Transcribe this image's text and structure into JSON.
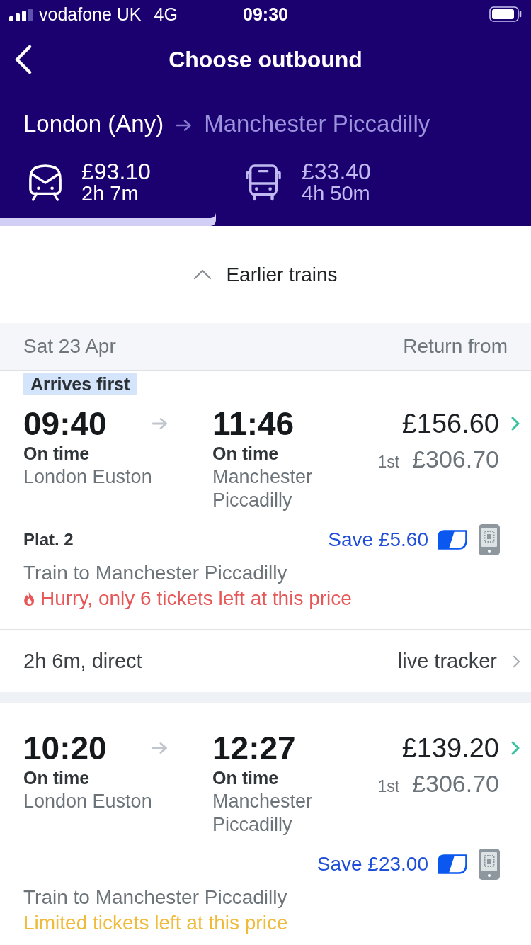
{
  "status_bar": {
    "carrier": "vodafone UK",
    "network": "4G",
    "time": "09:30"
  },
  "header": {
    "title": "Choose outbound",
    "origin": "London (Any)",
    "destination": "Manchester Piccadilly"
  },
  "modes": [
    {
      "kind": "train",
      "price": "£93.10",
      "duration": "2h 7m",
      "selected": true
    },
    {
      "kind": "coach",
      "price": "£33.40",
      "duration": "4h 50m",
      "selected": false
    }
  ],
  "earlier_button": {
    "label": "Earlier trains"
  },
  "date_header": {
    "date": "Sat 23 Apr",
    "column_label": "Return from"
  },
  "journeys": [
    {
      "badge": "Arrives first",
      "depart": {
        "time": "09:40",
        "status": "On time",
        "station": "London Euston"
      },
      "arrive": {
        "time": "11:46",
        "status": "On time",
        "station": "Manchester Piccadilly"
      },
      "price": "£156.60",
      "first_class": {
        "label": "1st",
        "price": "£306.70"
      },
      "platform": "Plat. 2",
      "saving": "Save £5.60",
      "service": "Train to Manchester Piccadilly",
      "availability": {
        "kind": "hurry",
        "text": "Hurry, only 6 tickets left at this price"
      },
      "summary": "2h 6m, direct",
      "tracker_link": "live tracker"
    },
    {
      "depart": {
        "time": "10:20",
        "status": "On time",
        "station": "London Euston"
      },
      "arrive": {
        "time": "12:27",
        "status": "On time",
        "station": "Manchester Piccadilly"
      },
      "price": "£139.20",
      "first_class": {
        "label": "1st",
        "price": "£306.70"
      },
      "saving": "Save £23.00",
      "service": "Train to Manchester Piccadilly",
      "availability": {
        "kind": "limited",
        "text": "Limited tickets left at this price"
      }
    }
  ]
}
